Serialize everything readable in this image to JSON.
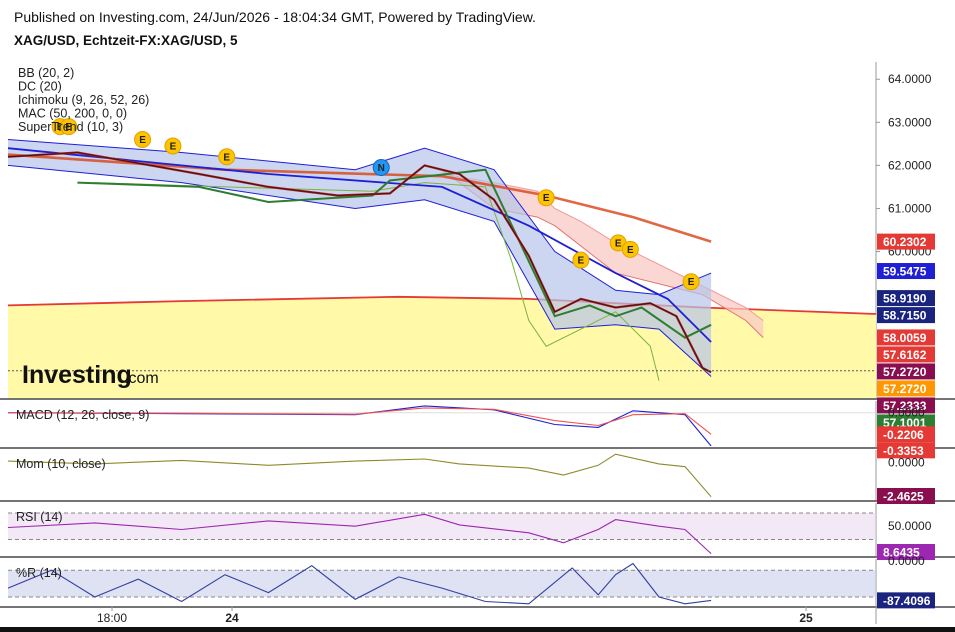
{
  "header": {
    "published": "Published on Investing.com, 24/Jun/2026 - 18:04:34 GMT, Powered by TradingView.",
    "symbol": "XAG/USD, Echtzeit-FX:XAG/USD, 5"
  },
  "logo": {
    "word": "Investing",
    "suffix": ".com"
  },
  "colors": {
    "red": "#e53935",
    "dark_red": "#880e4f",
    "orange": "#ff9800",
    "blue": "#1f1fd6",
    "navy": "#1a237e",
    "green": "#2e7d32",
    "dark_green": "#1b5e20",
    "purple": "#9c27b0",
    "yellow_fill": "#fff9a8",
    "cloud_red": "#f8c9c4",
    "cloud_green": "#c8e6c9",
    "bb_fill": "#b7c5ea",
    "mom_line": "#8d8a2c",
    "rsi_line": "#9c27b0",
    "wr_line": "#303f9f"
  },
  "chart_data": [
    {
      "name": "price",
      "type": "line",
      "title": "XAG/USD, Echtzeit-FX:XAG/USD, 5",
      "indicators": [
        "BB (20, 2)",
        "DC (20)",
        "Ichimoku (9, 26, 52, 26)",
        "MAC (50, 200, 0, 0)",
        "SuperTrend (10, 3)"
      ],
      "ylim": [
        56.6,
        64.4
      ],
      "y_ticks": [
        64.0,
        63.0,
        62.0,
        61.0,
        60.0
      ],
      "y_tick_labels": [
        "64.0000",
        "63.0000",
        "62.0000",
        "61.0000",
        "60.0000"
      ],
      "x_ticks": [
        "18:00",
        "24",
        "25"
      ],
      "price_labels": [
        {
          "text": "60.2302",
          "value": 60.2302,
          "color": "red"
        },
        {
          "text": "59.5475",
          "value": 59.5475,
          "color": "blue"
        },
        {
          "text": "58.9190",
          "value": 58.919,
          "color": "navy"
        },
        {
          "text": "58.7150",
          "value": 58.715,
          "color": "navy"
        },
        {
          "text": "58.0059",
          "value": 58.0059,
          "color": "red"
        },
        {
          "text": "57.6162",
          "value": 57.6162,
          "color": "red"
        },
        {
          "text": "57.2720",
          "value": 57.272,
          "color": "dark_red"
        },
        {
          "text": "57.2720",
          "value": 57.272,
          "color": "orange"
        },
        {
          "text": "57.2333",
          "value": 57.2333,
          "color": "dark_red"
        },
        {
          "text": "57.1001",
          "value": 57.1001,
          "color": "green"
        }
      ],
      "series": [
        {
          "name": "close",
          "x": [
            0,
            0.08,
            0.15,
            0.22,
            0.3,
            0.38,
            0.44,
            0.48,
            0.52,
            0.56,
            0.6,
            0.63,
            0.66,
            0.7,
            0.74,
            0.77,
            0.8,
            0.81
          ],
          "values": [
            62.2,
            62.3,
            62.05,
            61.8,
            61.5,
            61.3,
            61.35,
            62.0,
            61.8,
            61.2,
            59.9,
            58.6,
            58.9,
            58.7,
            58.8,
            58.5,
            57.3,
            57.2
          ]
        },
        {
          "name": "MA200",
          "x": [
            0,
            0.25,
            0.5,
            0.62,
            0.72,
            0.81
          ],
          "values": [
            62.25,
            61.9,
            61.75,
            61.3,
            60.8,
            60.23
          ]
        },
        {
          "name": "MA50",
          "x": [
            0,
            0.3,
            0.5,
            0.6,
            0.7,
            0.76,
            0.81
          ],
          "values": [
            62.4,
            61.8,
            61.5,
            60.6,
            59.5,
            58.9,
            57.9
          ]
        },
        {
          "name": "SuperTrend",
          "x": [
            0.08,
            0.22,
            0.3,
            0.42,
            0.44,
            0.55,
            0.63,
            0.67,
            0.7,
            0.73,
            0.78,
            0.81
          ],
          "values": [
            61.6,
            61.5,
            61.15,
            61.3,
            61.65,
            61.9,
            58.5,
            58.75,
            58.5,
            58.7,
            58.0,
            58.3
          ]
        },
        {
          "name": "Ichimoku lagging",
          "x": [
            0.1,
            0.25,
            0.42,
            0.48,
            0.55,
            0.58,
            0.6,
            0.62,
            0.7,
            0.74,
            0.75
          ],
          "values": [
            61.6,
            61.5,
            61.4,
            61.6,
            61.5,
            59.8,
            58.4,
            57.8,
            58.6,
            57.8,
            57.0
          ]
        },
        {
          "name": "Ichimoku cloud A",
          "x": [
            0.5,
            0.56,
            0.61,
            0.63,
            0.7,
            0.8,
            0.85,
            0.87
          ],
          "values": [
            61.9,
            61.0,
            60.8,
            60.6,
            59.5,
            59.0,
            58.4,
            58.0
          ]
        },
        {
          "name": "Ichimoku cloud B",
          "x": [
            0.5,
            0.56,
            0.61,
            0.63,
            0.66,
            0.7,
            0.8,
            0.85,
            0.87
          ],
          "values": [
            61.8,
            61.6,
            61.4,
            61.0,
            60.7,
            60.2,
            59.2,
            58.7,
            58.4
          ]
        },
        {
          "name": "BB upper",
          "x": [
            0,
            0.2,
            0.4,
            0.48,
            0.56,
            0.63,
            0.7,
            0.75,
            0.81
          ],
          "values": [
            62.6,
            62.3,
            61.9,
            62.4,
            61.9,
            60.0,
            59.1,
            59.0,
            59.5
          ]
        },
        {
          "name": "BB lower",
          "x": [
            0,
            0.2,
            0.4,
            0.48,
            0.56,
            0.63,
            0.7,
            0.75,
            0.81
          ],
          "values": [
            62.0,
            61.6,
            61.0,
            61.2,
            60.7,
            58.2,
            58.3,
            58.2,
            57.1
          ]
        }
      ],
      "yellow_curve": {
        "x": [
          0,
          0.2,
          0.45,
          0.6,
          0.8,
          1.0
        ],
        "values": [
          58.75,
          58.85,
          58.95,
          58.9,
          58.7,
          58.55
        ],
        "fill_to": 56.6
      },
      "events": [
        {
          "label": "E",
          "x": 0.06,
          "y": 62.9
        },
        {
          "label": "E",
          "x": 0.07,
          "y": 62.9
        },
        {
          "label": "E",
          "x": 0.155,
          "y": 62.6
        },
        {
          "label": "E",
          "x": 0.19,
          "y": 62.45
        },
        {
          "label": "E",
          "x": 0.252,
          "y": 62.2
        },
        {
          "label": "N",
          "x": 0.43,
          "y": 61.95
        },
        {
          "label": "E",
          "x": 0.62,
          "y": 61.25
        },
        {
          "label": "E",
          "x": 0.66,
          "y": 59.8
        },
        {
          "label": "E",
          "x": 0.703,
          "y": 60.2
        },
        {
          "label": "E",
          "x": 0.717,
          "y": 60.05
        },
        {
          "label": "E",
          "x": 0.787,
          "y": 59.3
        }
      ]
    },
    {
      "name": "macd",
      "type": "line",
      "title": "MACD (12, 26, close, 9)",
      "ylim": [
        -0.35,
        0.12
      ],
      "y_tick_labels": [
        "0.0000"
      ],
      "y_ticks": [
        0.0
      ],
      "value_labels": [
        {
          "text": "-0.2206",
          "value": -0.2206,
          "color": "red"
        },
        {
          "text": "-0.3353",
          "value": -0.3353,
          "color": "red"
        }
      ],
      "series": [
        {
          "name": "MACD",
          "x": [
            0,
            0.2,
            0.4,
            0.48,
            0.56,
            0.63,
            0.68,
            0.72,
            0.78,
            0.81
          ],
          "values": [
            0.0,
            -0.01,
            -0.02,
            0.07,
            0.03,
            -0.12,
            -0.15,
            0.02,
            -0.02,
            -0.34
          ]
        },
        {
          "name": "Signal",
          "x": [
            0,
            0.2,
            0.4,
            0.48,
            0.56,
            0.63,
            0.68,
            0.72,
            0.78,
            0.81
          ],
          "values": [
            0.0,
            -0.005,
            -0.015,
            0.05,
            0.035,
            -0.08,
            -0.13,
            -0.02,
            -0.01,
            -0.22
          ]
        }
      ]
    },
    {
      "name": "mom",
      "type": "line",
      "title": "Mom (10, close)",
      "ylim": [
        -2.7,
        0.9
      ],
      "y_tick_labels": [
        "0.0000"
      ],
      "y_ticks": [
        0.0
      ],
      "value_labels": [
        {
          "text": "-2.4625",
          "value": -2.4625,
          "color": "dark_red"
        }
      ],
      "series": [
        {
          "name": "Mom",
          "x": [
            0,
            0.1,
            0.2,
            0.3,
            0.4,
            0.48,
            0.52,
            0.6,
            0.64,
            0.68,
            0.7,
            0.75,
            0.78,
            0.81
          ],
          "values": [
            0.1,
            -0.1,
            0.15,
            -0.2,
            0.1,
            0.25,
            -0.1,
            -0.4,
            -0.9,
            -0.2,
            0.6,
            -0.1,
            -0.3,
            -2.46
          ]
        }
      ]
    },
    {
      "name": "rsi",
      "type": "line",
      "title": "RSI (14)",
      "ylim": [
        5,
        85
      ],
      "y_tick_labels": [
        "50.0000"
      ],
      "y_ticks": [
        50
      ],
      "bands": [
        30,
        70
      ],
      "value_labels": [
        {
          "text": "8.6435",
          "value": 8.6435,
          "color": "purple"
        }
      ],
      "series": [
        {
          "name": "RSI",
          "x": [
            0,
            0.1,
            0.2,
            0.3,
            0.4,
            0.48,
            0.52,
            0.6,
            0.64,
            0.68,
            0.7,
            0.75,
            0.78,
            0.81
          ],
          "values": [
            48,
            55,
            45,
            58,
            50,
            68,
            52,
            40,
            25,
            45,
            60,
            50,
            45,
            8.6
          ]
        }
      ]
    },
    {
      "name": "williams_r",
      "type": "line",
      "title": "%R (14)",
      "ylim": [
        -100,
        5
      ],
      "y_tick_labels": [
        "0.0000"
      ],
      "y_ticks": [
        0
      ],
      "bands": [
        -20,
        -80
      ],
      "value_labels": [
        {
          "text": "-87.4096",
          "value": -87.4096,
          "color": "navy"
        }
      ],
      "series": [
        {
          "name": "%R",
          "x": [
            0,
            0.05,
            0.1,
            0.15,
            0.2,
            0.25,
            0.3,
            0.35,
            0.4,
            0.45,
            0.5,
            0.55,
            0.6,
            0.65,
            0.68,
            0.7,
            0.72,
            0.75,
            0.78,
            0.81
          ],
          "values": [
            -60,
            -20,
            -80,
            -40,
            -90,
            -30,
            -70,
            -10,
            -85,
            -35,
            -60,
            -90,
            -95,
            -15,
            -75,
            -30,
            -5,
            -80,
            -95,
            -87.4
          ]
        }
      ]
    }
  ]
}
